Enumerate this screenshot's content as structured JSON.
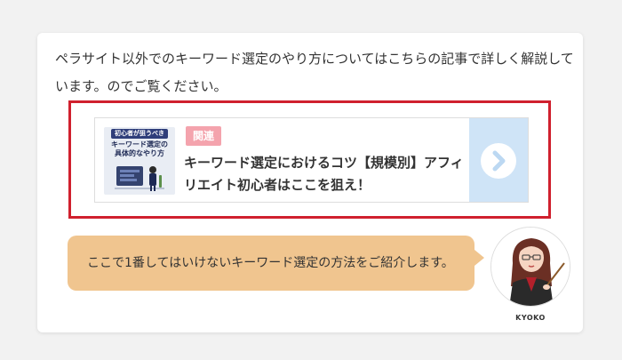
{
  "intro_text": "ペラサイト以外でのキーワード選定のやり方についてはこちらの記事で詳しく解説しています。のでご覧ください。",
  "related": {
    "badge": "関連",
    "title": "キーワード選定におけるコツ【規模別】アフィリエイト初心者はここを狙え！",
    "thumbnail": {
      "tag": "初心者が狙うべき",
      "title_line1": "キーワード選定の",
      "title_line2": "具体的なやり方"
    },
    "arrow_icon": "chevron-right-icon"
  },
  "speech": {
    "text": "ここで1番してはいけないキーワード選定の方法をご紹介します。",
    "speaker_name": "KYOKO"
  },
  "colors": {
    "highlight_border": "#d0202e",
    "badge": "#f4a3ad",
    "arrow_panel": "#cfe4f7",
    "bubble": "#f0c58f"
  }
}
